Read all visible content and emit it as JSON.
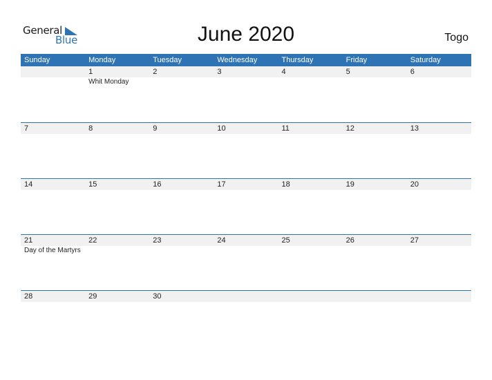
{
  "logo": {
    "line1": "General",
    "line2": "Blue",
    "icon": "triangle-flag-icon"
  },
  "title": "June 2020",
  "country": "Togo",
  "weekdays": [
    "Sunday",
    "Monday",
    "Tuesday",
    "Wednesday",
    "Thursday",
    "Friday",
    "Saturday"
  ],
  "weeks": [
    [
      {
        "d": "",
        "e": ""
      },
      {
        "d": "1",
        "e": "Whit Monday"
      },
      {
        "d": "2",
        "e": ""
      },
      {
        "d": "3",
        "e": ""
      },
      {
        "d": "4",
        "e": ""
      },
      {
        "d": "5",
        "e": ""
      },
      {
        "d": "6",
        "e": ""
      }
    ],
    [
      {
        "d": "7",
        "e": ""
      },
      {
        "d": "8",
        "e": ""
      },
      {
        "d": "9",
        "e": ""
      },
      {
        "d": "10",
        "e": ""
      },
      {
        "d": "11",
        "e": ""
      },
      {
        "d": "12",
        "e": ""
      },
      {
        "d": "13",
        "e": ""
      }
    ],
    [
      {
        "d": "14",
        "e": ""
      },
      {
        "d": "15",
        "e": ""
      },
      {
        "d": "16",
        "e": ""
      },
      {
        "d": "17",
        "e": ""
      },
      {
        "d": "18",
        "e": ""
      },
      {
        "d": "19",
        "e": ""
      },
      {
        "d": "20",
        "e": ""
      }
    ],
    [
      {
        "d": "21",
        "e": "Day of the Martyrs"
      },
      {
        "d": "22",
        "e": ""
      },
      {
        "d": "23",
        "e": ""
      },
      {
        "d": "24",
        "e": ""
      },
      {
        "d": "25",
        "e": ""
      },
      {
        "d": "26",
        "e": ""
      },
      {
        "d": "27",
        "e": ""
      }
    ],
    [
      {
        "d": "28",
        "e": ""
      },
      {
        "d": "29",
        "e": ""
      },
      {
        "d": "30",
        "e": ""
      },
      {
        "d": "",
        "e": ""
      },
      {
        "d": "",
        "e": ""
      },
      {
        "d": "",
        "e": ""
      },
      {
        "d": "",
        "e": ""
      }
    ]
  ],
  "colors": {
    "accent": "#2e74b5",
    "date_strip": "#f1f1f1"
  }
}
